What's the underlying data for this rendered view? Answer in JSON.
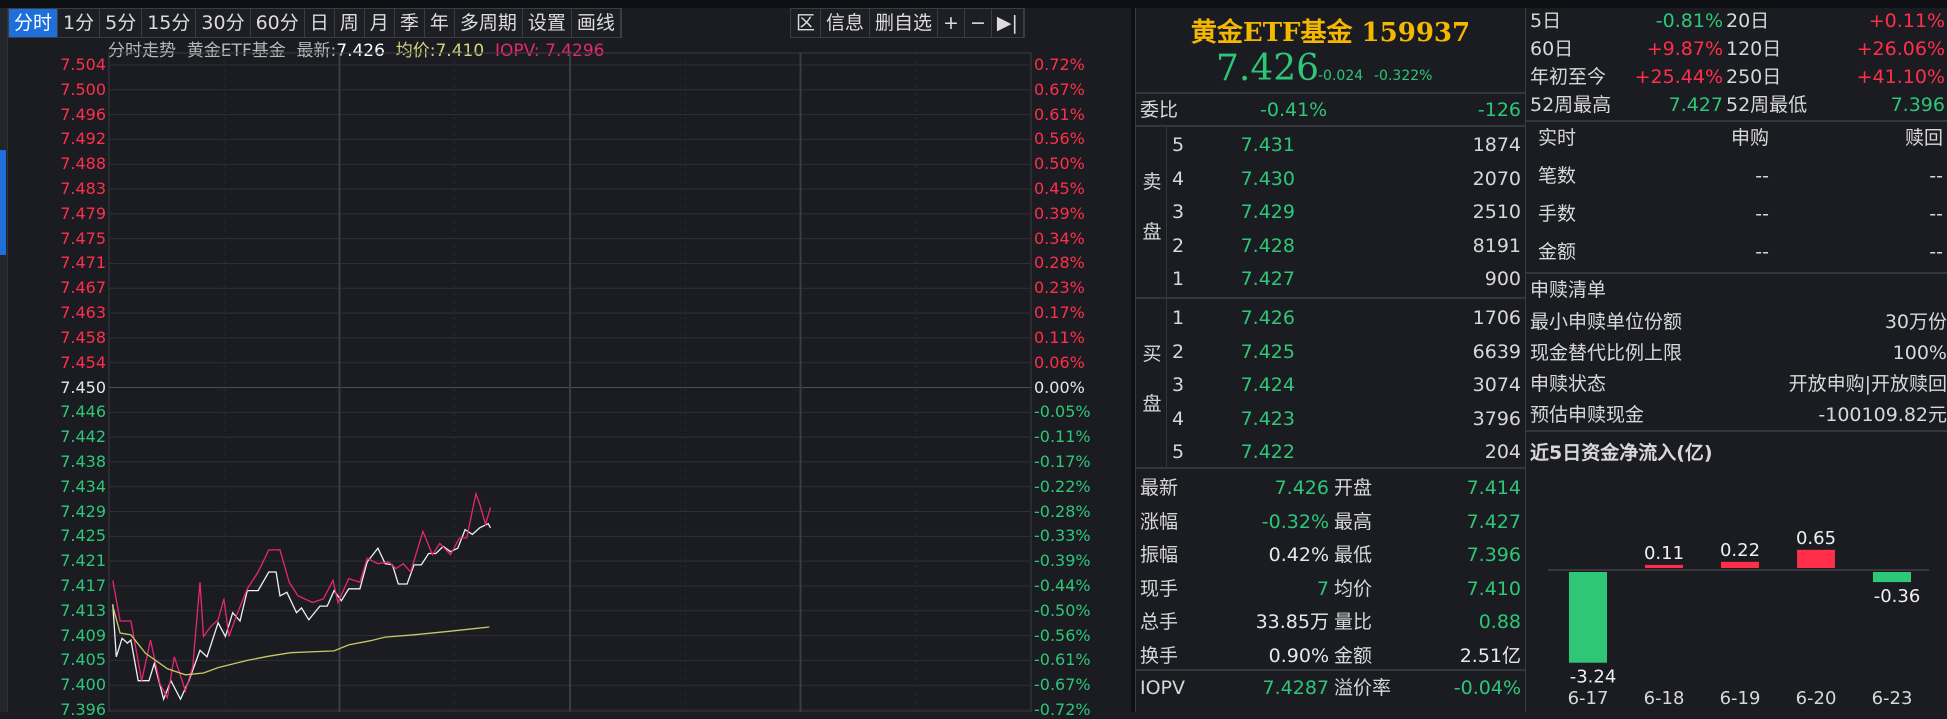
{
  "toolbar": {
    "left": [
      "分时",
      "1分",
      "5分",
      "15分",
      "30分",
      "60分",
      "日",
      "周",
      "月",
      "季",
      "年",
      "多周期",
      "设置",
      "画线"
    ],
    "right": [
      "区",
      "信息",
      "删自选",
      "+",
      "−",
      "▶|"
    ],
    "active": "分时"
  },
  "info": {
    "mode": "分时走势",
    "name": "黄金ETF基金",
    "latest_label": "最新:",
    "latest": "7.426",
    "avg_label": "均价:",
    "avg": "7.410",
    "iopv_label": "IOPV:",
    "iopv": "7.4296"
  },
  "chart_data": {
    "type": "line",
    "title": "分时走势",
    "pre_close": 7.45,
    "ylim": [
      7.396,
      7.504
    ],
    "x_range_minutes": [
      0,
      240
    ],
    "y_left_ticks": [
      "7.504",
      "7.500",
      "7.496",
      "7.492",
      "7.488",
      "7.483",
      "7.479",
      "7.475",
      "7.471",
      "7.467",
      "7.463",
      "7.458",
      "7.454",
      "7.450",
      "7.446",
      "7.442",
      "7.438",
      "7.434",
      "7.429",
      "7.425",
      "7.421",
      "7.417",
      "7.413",
      "7.409",
      "7.405",
      "7.400",
      "7.396"
    ],
    "y_right_ticks": [
      "0.72%",
      "0.67%",
      "0.61%",
      "0.56%",
      "0.50%",
      "0.45%",
      "0.39%",
      "0.34%",
      "0.28%",
      "0.23%",
      "0.17%",
      "0.11%",
      "0.06%",
      "0.00%",
      "-0.05%",
      "-0.11%",
      "-0.17%",
      "-0.22%",
      "-0.28%",
      "-0.33%",
      "-0.39%",
      "-0.44%",
      "-0.50%",
      "-0.56%",
      "-0.61%",
      "-0.67%",
      "-0.72%"
    ],
    "series": [
      {
        "name": "price",
        "color": "#f0f0f0",
        "points": [
          [
            1,
            7.4137
          ],
          [
            1.9,
            7.4049
          ],
          [
            3.4,
            7.408
          ],
          [
            4.8,
            7.4072
          ],
          [
            5.7,
            7.4077
          ],
          [
            7.6,
            7.4009
          ],
          [
            10.4,
            7.4009
          ],
          [
            11.8,
            7.4038
          ],
          [
            14.2,
            7.3978
          ],
          [
            16.1,
            7.4009
          ],
          [
            18.6,
            7.3978
          ],
          [
            20.8,
            7.4009
          ],
          [
            23.7,
            7.406
          ],
          [
            25.5,
            7.4049
          ],
          [
            28.4,
            7.4106
          ],
          [
            30.3,
            7.4083
          ],
          [
            32.2,
            7.4123
          ],
          [
            34.1,
            7.4109
          ],
          [
            36,
            7.416
          ],
          [
            38.8,
            7.416
          ],
          [
            41.6,
            7.4191
          ],
          [
            43.5,
            7.4191
          ],
          [
            44.5,
            7.4151
          ],
          [
            46.3,
            7.4157
          ],
          [
            48.8,
            7.4123
          ],
          [
            50.1,
            7.4131
          ],
          [
            52,
            7.4111
          ],
          [
            54.9,
            7.4134
          ],
          [
            56.8,
            7.4134
          ],
          [
            58.6,
            7.416
          ],
          [
            60.5,
            7.4143
          ],
          [
            62.4,
            7.4163
          ],
          [
            65.3,
            7.4163
          ],
          [
            67.2,
            7.4208
          ],
          [
            70,
            7.4231
          ],
          [
            71.9,
            7.4205
          ],
          [
            73.8,
            7.4203
          ],
          [
            75.3,
            7.4171
          ],
          [
            77.6,
            7.4171
          ],
          [
            79.4,
            7.4203
          ],
          [
            81.3,
            7.4203
          ],
          [
            83.2,
            7.4222
          ],
          [
            85.1,
            7.4222
          ],
          [
            87,
            7.4234
          ],
          [
            88.9,
            7.4225
          ],
          [
            90.8,
            7.4231
          ],
          [
            92.7,
            7.4262
          ],
          [
            94.6,
            7.4254
          ],
          [
            96.5,
            7.4265
          ],
          [
            98.7,
            7.4272
          ],
          [
            99.3,
            7.4265
          ]
        ]
      },
      {
        "name": "IOPV",
        "color": "#e6286e",
        "points": [
          [
            1,
            7.4177
          ],
          [
            2.9,
            7.4109
          ],
          [
            5.7,
            7.4109
          ],
          [
            8.5,
            7.4009
          ],
          [
            10.8,
            7.4077
          ],
          [
            13.3,
            7.4003
          ],
          [
            15.2,
            7.3981
          ],
          [
            17,
            7.4049
          ],
          [
            19.9,
            7.3992
          ],
          [
            21.8,
            7.4032
          ],
          [
            23.7,
            7.4174
          ],
          [
            24.6,
            7.4083
          ],
          [
            26.5,
            7.41
          ],
          [
            28.4,
            7.4111
          ],
          [
            29.9,
            7.4146
          ],
          [
            31.2,
            7.4083
          ],
          [
            33.1,
            7.4117
          ],
          [
            36,
            7.4163
          ],
          [
            38.8,
            7.4191
          ],
          [
            41.6,
            7.4228
          ],
          [
            44.5,
            7.4228
          ],
          [
            46.9,
            7.4174
          ],
          [
            49.2,
            7.4151
          ],
          [
            53,
            7.414
          ],
          [
            55.8,
            7.4146
          ],
          [
            58.3,
            7.4177
          ],
          [
            59.6,
            7.414
          ],
          [
            62.4,
            7.418
          ],
          [
            65.3,
            7.4174
          ],
          [
            67.2,
            7.4214
          ],
          [
            70,
            7.4205
          ],
          [
            72.8,
            7.4208
          ],
          [
            74.7,
            7.4197
          ],
          [
            76.6,
            7.4205
          ],
          [
            78.5,
            7.4191
          ],
          [
            81.7,
            7.4259
          ],
          [
            84.2,
            7.422
          ],
          [
            86.1,
            7.4239
          ],
          [
            88.9,
            7.422
          ],
          [
            91.2,
            7.4248
          ],
          [
            93.1,
            7.4248
          ],
          [
            95.5,
            7.4322
          ],
          [
            96.5,
            7.4305
          ],
          [
            98,
            7.4271
          ],
          [
            99.3,
            7.4299
          ]
        ]
      },
      {
        "name": "avg",
        "color": "#c8c864",
        "points": [
          [
            1,
            7.4134
          ],
          [
            2.9,
            7.4089
          ],
          [
            5.7,
            7.4086
          ],
          [
            9.5,
            7.4055
          ],
          [
            15.2,
            7.4029
          ],
          [
            19.9,
            7.4019
          ],
          [
            24.6,
            7.4022
          ],
          [
            28.4,
            7.4031
          ],
          [
            36,
            7.4043
          ],
          [
            41.6,
            7.405
          ],
          [
            47.3,
            7.4056
          ],
          [
            58.6,
            7.4059
          ],
          [
            62.4,
            7.4069
          ],
          [
            68.1,
            7.4076
          ],
          [
            71.9,
            7.4082
          ],
          [
            79.4,
            7.4086
          ],
          [
            88.9,
            7.4092
          ],
          [
            94.6,
            7.4096
          ],
          [
            99,
            7.4099
          ]
        ]
      }
    ]
  },
  "quote": {
    "title": "黄金ETF基金 159937",
    "price": "7.426",
    "change": "-0.024",
    "change_pct": "-0.322%",
    "weibi_label": "委比",
    "weibi": "-0.41%",
    "weicha": "-126",
    "sell_label": [
      "卖",
      "盘"
    ],
    "buy_label": [
      "买",
      "盘"
    ],
    "sell": [
      {
        "lv": "5",
        "p": "7.431",
        "v": "1874"
      },
      {
        "lv": "4",
        "p": "7.430",
        "v": "2070"
      },
      {
        "lv": "3",
        "p": "7.429",
        "v": "2510"
      },
      {
        "lv": "2",
        "p": "7.428",
        "v": "8191"
      },
      {
        "lv": "1",
        "p": "7.427",
        "v": "900"
      }
    ],
    "buy": [
      {
        "lv": "1",
        "p": "7.426",
        "v": "1706"
      },
      {
        "lv": "2",
        "p": "7.425",
        "v": "6639"
      },
      {
        "lv": "3",
        "p": "7.424",
        "v": "3074"
      },
      {
        "lv": "4",
        "p": "7.423",
        "v": "3796"
      },
      {
        "lv": "5",
        "p": "7.422",
        "v": "204"
      }
    ],
    "stats": [
      {
        "l1": "最新",
        "v1": "7.426",
        "c1": "dn",
        "l2": "开盘",
        "v2": "7.414",
        "c2": "dn"
      },
      {
        "l1": "涨幅",
        "v1": "-0.32%",
        "c1": "dn",
        "l2": "最高",
        "v2": "7.427",
        "c2": "dn"
      },
      {
        "l1": "振幅",
        "v1": "0.42%",
        "c1": "wh",
        "l2": "最低",
        "v2": "7.396",
        "c2": "dn"
      },
      {
        "l1": "现手",
        "v1": "7",
        "c1": "dn",
        "l2": "均价",
        "v2": "7.410",
        "c2": "dn"
      },
      {
        "l1": "总手",
        "v1": "33.85万",
        "c1": "wh",
        "l2": "量比",
        "v2": "0.88",
        "c2": "dn"
      },
      {
        "l1": "换手",
        "v1": "0.90%",
        "c1": "wh",
        "l2": "金额",
        "v2": "2.51亿",
        "c2": "wh"
      },
      {
        "l1": "IOPV",
        "v1": "7.4287",
        "c1": "dn",
        "l2": "溢价率",
        "v2": "-0.04%",
        "c2": "dn"
      }
    ]
  },
  "perf": [
    {
      "l1": "5日",
      "v1": "-0.81%",
      "c1": "dn",
      "l2": "20日",
      "v2": "+0.11%",
      "c2": "up"
    },
    {
      "l1": "60日",
      "v1": "+9.87%",
      "c1": "up",
      "l2": "120日",
      "v2": "+26.06%",
      "c2": "up"
    },
    {
      "l1": "年初至今",
      "v1": "+25.44%",
      "c1": "up",
      "l2": "250日",
      "v2": "+41.10%",
      "c2": "up"
    },
    {
      "l1": "52周最高",
      "v1": "7.427",
      "c1": "dn",
      "l2": "52周最低",
      "v2": "7.396",
      "c2": "dn"
    }
  ],
  "realtime": {
    "header": [
      "实时",
      "申购",
      "赎回"
    ],
    "rows": [
      [
        "笔数",
        "--",
        "--"
      ],
      [
        "手数",
        "--",
        "--"
      ],
      [
        "金额",
        "--",
        "--"
      ]
    ]
  },
  "redeem": {
    "title": "申赎清单",
    "rows": [
      [
        "最小申赎单位份额",
        "30万份"
      ],
      [
        "现金替代比例上限",
        "100%"
      ],
      [
        "申赎状态",
        "开放申购|开放赎回"
      ],
      [
        "预估申赎现金",
        "-100109.82元"
      ]
    ]
  },
  "flow": {
    "title": "近5日资金净流入(亿)",
    "categories": [
      "6-17",
      "6-18",
      "6-19",
      "6-20",
      "6-23"
    ],
    "values": [
      -3.24,
      0.11,
      0.22,
      0.65,
      -0.36
    ],
    "labels": [
      "-3.24",
      "0.11",
      "0.22",
      "0.65",
      "-0.36"
    ],
    "up_color": "#ff2f4b",
    "down_color": "#2dc777"
  }
}
